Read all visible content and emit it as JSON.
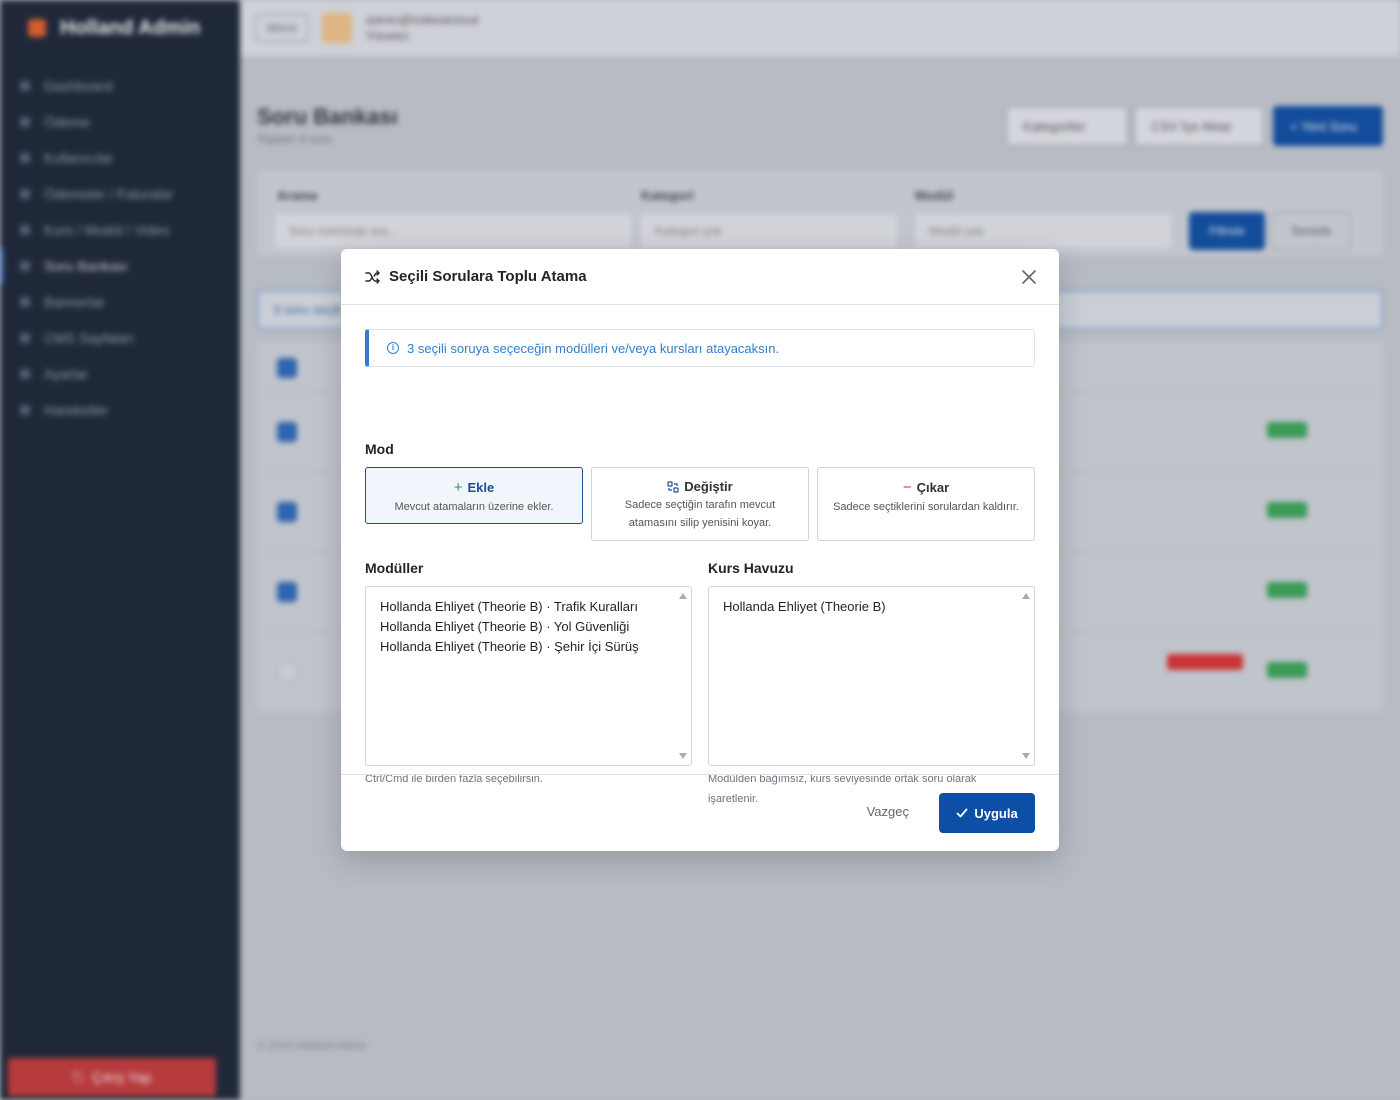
{
  "background": {
    "brand": "Holland Admin",
    "nav_items": [
      "Dashboard",
      "Ödeme",
      "Kullanıcılar",
      "Ödemeler / Faturalar",
      "Kurs / Modül / Video",
      "Soru Bankası",
      "Bannerlar",
      "CMS Sayfaları",
      "Ayarlar",
      "Hareketler"
    ],
    "logout_label": "Çıkış Yap",
    "topbar": {
      "menu_label": "Menü",
      "user_email": "admin@hollandcloud",
      "user_role": "Yönetici"
    },
    "page_title": "Soru Bankası",
    "page_subtitle": "Toplam 4 soru",
    "header_buttons": {
      "categories": "Kategoriler",
      "csv": "CSV İçe Aktar",
      "new": "+ Yeni Soru"
    },
    "filters": {
      "search_label": "Arama",
      "search_placeholder": "Soru metninde ara...",
      "category_label": "Kategori",
      "category_placeholder": "Kategori yok",
      "module_label": "Modül",
      "module_placeholder": "Modül yok",
      "filter_button": "Filtrele",
      "reset_button": "Temizle"
    },
    "bulk_text": "3 soru seçili",
    "footer": "© 2024 Holland Admin"
  },
  "modal": {
    "title": "Seçili Sorulara Toplu Atama",
    "info": "3 seçili soruya seçeceğin modülleri ve/veya kursları atayacaksın.",
    "mode_label": "Mod",
    "modes": [
      {
        "title": "Ekle",
        "desc": "Mevcut atamaların üzerine ekler.",
        "icon": "plus-icon",
        "selected": true
      },
      {
        "title": "Değiştir",
        "desc": "Sadece seçtiğin tarafın mevcut atamasını silip yenisini koyar.",
        "icon": "swap-icon",
        "selected": false
      },
      {
        "title": "Çıkar",
        "desc": "Sadece seçtiklerini sorulardan kaldırır.",
        "icon": "minus-icon",
        "selected": false
      }
    ],
    "modules_label": "Modüller",
    "modules": [
      "Hollanda Ehliyet (Theorie B) · Trafik Kuralları",
      "Hollanda Ehliyet (Theorie B) · Yol Güvenliği",
      "Hollanda Ehliyet (Theorie B) · Şehir İçi Sürüş"
    ],
    "modules_help": "Ctrl/Cmd ile birden fazla seçebilirsin.",
    "courses_label": "Kurs Havuzu",
    "courses": [
      "Hollanda Ehliyet (Theorie B)"
    ],
    "courses_help": "Modülden bağımsız, kurs seviyesinde ortak soru olarak işaretlenir.",
    "cancel_label": "Vazgeç",
    "apply_label": "Uygula",
    "accent_color": "#0d4ea6",
    "info_color": "#2f7fd0"
  }
}
